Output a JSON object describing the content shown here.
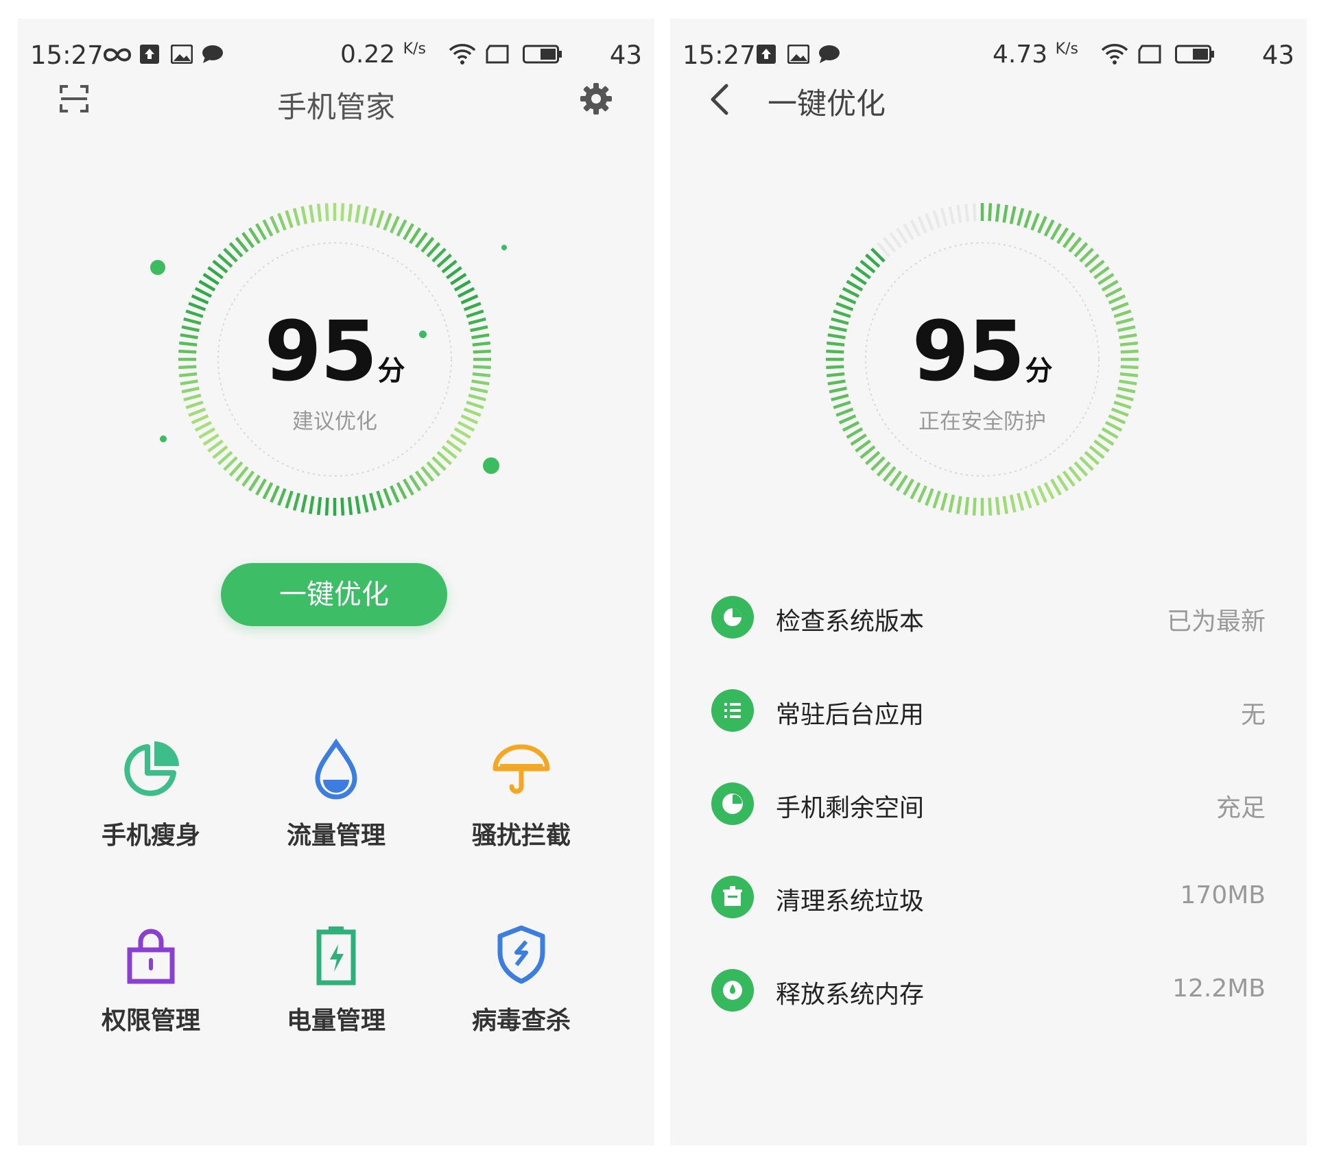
{
  "left_screen": {
    "status_bar": {
      "time": "15:27",
      "speed_value": "0.22",
      "speed_unit": "K/s",
      "battery": "43"
    },
    "header": {
      "title": "手机管家",
      "scan_icon": "scan-icon",
      "settings_icon": "gear-icon"
    },
    "score": {
      "value": "95",
      "unit": "分",
      "caption": "建议优化"
    },
    "optimize_button": "一键优化",
    "tools": [
      {
        "label": "手机瘦身",
        "icon": "pie-chart-icon",
        "color": "#3dbd8a"
      },
      {
        "label": "流量管理",
        "icon": "water-drop-icon",
        "color": "#3b7de0"
      },
      {
        "label": "骚扰拦截",
        "icon": "umbrella-icon",
        "color": "#f5a623"
      },
      {
        "label": "权限管理",
        "icon": "lock-icon",
        "color": "#8a3fd1"
      },
      {
        "label": "电量管理",
        "icon": "battery-icon",
        "color": "#2fb07b"
      },
      {
        "label": "病毒查杀",
        "icon": "shield-icon",
        "color": "#3b7de0"
      }
    ]
  },
  "right_screen": {
    "status_bar": {
      "time": "15:27",
      "speed_value": "4.73",
      "speed_unit": "K/s",
      "battery": "43"
    },
    "header": {
      "title": "一键优化",
      "back_icon": "back-arrow-icon"
    },
    "score": {
      "value": "95",
      "unit": "分",
      "caption": "正在安全防护",
      "progress": 0.88
    },
    "checks": [
      {
        "label": "检查系统版本",
        "value": "已为最新",
        "icon": "version-icon"
      },
      {
        "label": "常驻后台应用",
        "value": "无",
        "icon": "list-icon"
      },
      {
        "label": "手机剩余空间",
        "value": "充足",
        "icon": "storage-pie-icon"
      },
      {
        "label": "清理系统垃圾",
        "value": "170MB",
        "icon": "trash-icon"
      },
      {
        "label": "释放系统内存",
        "value": "12.2MB",
        "icon": "memory-gauge-icon"
      }
    ]
  },
  "colors": {
    "accent": "#3dbd66",
    "ring_dark": "#2eaa48",
    "ring_light": "#a6e07a"
  }
}
